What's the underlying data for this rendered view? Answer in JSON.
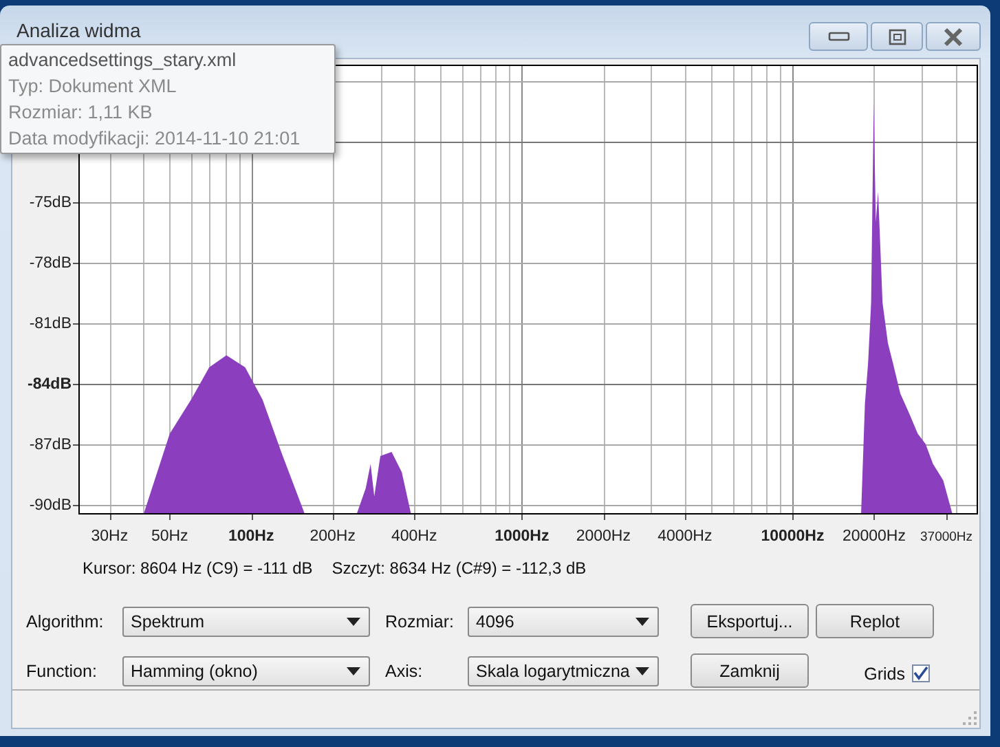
{
  "window": {
    "title": "Analiza widma"
  },
  "tooltip": {
    "lines": [
      "advancedsettings_stary.xml",
      "Typ: Dokument XML",
      "Rozmiar: 1,11 KB",
      "Data modyfikacji: 2014-11-10 21:01"
    ]
  },
  "spectrum_plot": {
    "x_labels": [
      {
        "text": "30Hz",
        "emphasized": false
      },
      {
        "text": "50Hz",
        "emphasized": false
      },
      {
        "text": "100Hz",
        "emphasized": true
      },
      {
        "text": "200Hz",
        "emphasized": false
      },
      {
        "text": "400Hz",
        "emphasized": false
      },
      {
        "text": "1000Hz",
        "emphasized": true
      },
      {
        "text": "2000Hz",
        "emphasized": false
      },
      {
        "text": "4000Hz",
        "emphasized": false
      },
      {
        "text": "10000Hz",
        "emphasized": true
      },
      {
        "text": "20000Hz",
        "emphasized": false
      },
      {
        "text": "37000Hz",
        "emphasized": false
      }
    ],
    "y_labels": [
      {
        "text": "-75dB",
        "emphasized": false
      },
      {
        "text": "-78dB",
        "emphasized": false
      },
      {
        "text": "-81dB",
        "emphasized": false
      },
      {
        "text": "-84dB",
        "emphasized": true
      },
      {
        "text": "-87dB",
        "emphasized": false
      },
      {
        "text": "-90dB",
        "emphasized": false
      }
    ]
  },
  "readout": {
    "cursor": "Kursor: 8604 Hz (C9) = -111 dB",
    "peak": "Szczyt: 8634 Hz (C#9) = -112,3 dB"
  },
  "controls": {
    "algorithm": {
      "label": "Algorithm:",
      "value": "Spektrum"
    },
    "size": {
      "label": "Rozmiar:",
      "value": "4096"
    },
    "function": {
      "label": "Function:",
      "value": "Hamming (okno)"
    },
    "axis": {
      "label": "Axis:",
      "value": "Skala logarytmiczna"
    },
    "export_button": "Eksportuj...",
    "replot_button": "Replot",
    "close_button": "Zamknij",
    "grids": {
      "label": "Grids",
      "checked": true
    }
  }
}
